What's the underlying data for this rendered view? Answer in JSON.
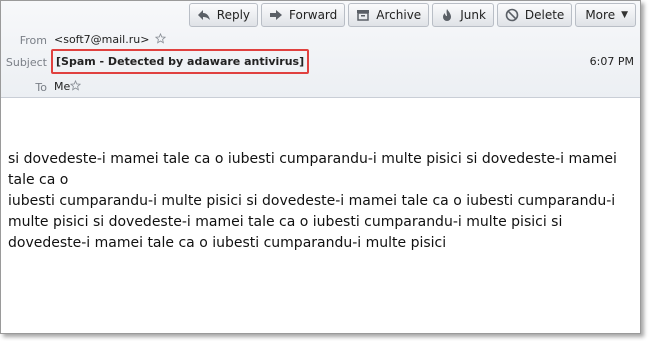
{
  "toolbar": {
    "reply": "Reply",
    "forward": "Forward",
    "archive": "Archive",
    "junk": "Junk",
    "delete": "Delete",
    "more": "More"
  },
  "header": {
    "from_label": "From",
    "from_value": "<soft7@mail.ru>",
    "subject_label": "Subject",
    "subject_value": "[Spam - Detected by adaware antivirus]",
    "time": "6:07 PM",
    "to_label": "To",
    "to_value": "Me"
  },
  "body": {
    "paragraph1": "si dovedeste-i mamei tale ca o iubesti cumparandu-i multe pisici si dovedeste-i mamei tale ca o",
    "paragraph2": "iubesti cumparandu-i multe pisici si dovedeste-i mamei tale ca o iubesti cumparandu-i multe pisici si dovedeste-i mamei tale ca o iubesti cumparandu-i multe pisici si dovedeste-i mamei tale ca o iubesti cumparandu-i multe pisici"
  },
  "colors": {
    "highlight_border": "#e0413f"
  },
  "icons": {
    "reply": "reply-arrow-icon",
    "forward": "forward-arrow-icon",
    "archive": "archive-box-icon",
    "junk": "junk-flame-icon",
    "delete": "delete-circle-icon",
    "more": "chevron-down-icon",
    "star": "star-outline-icon"
  }
}
